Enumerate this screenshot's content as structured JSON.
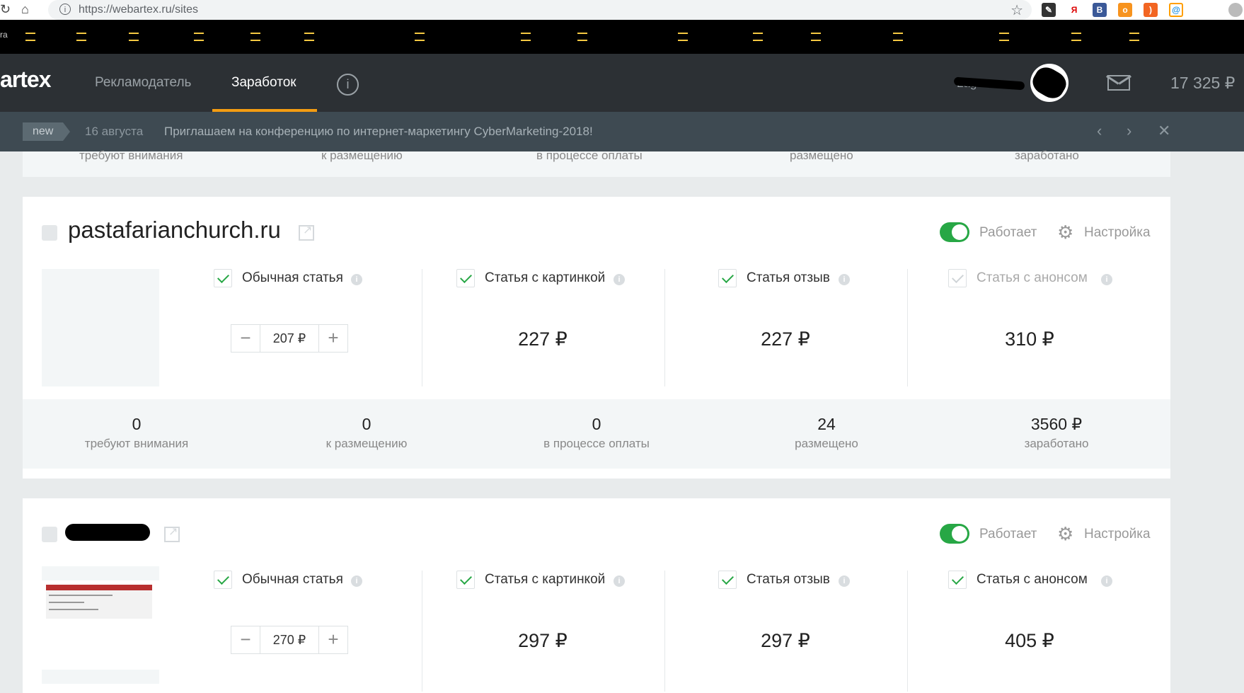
{
  "browser": {
    "url": "https://webartex.ru/sites",
    "bookmarks_left_text": "ra"
  },
  "header": {
    "logo": "artex",
    "nav": [
      "Рекламодатель",
      "Заработок"
    ],
    "user_name": "Lag",
    "balance": "17 325 ₽"
  },
  "announcement": {
    "badge": "new",
    "date": "16 августа",
    "text": "Приглашаем на конференцию по интернет-маркетингу CyberMarketing-2018!"
  },
  "top_strip": {
    "labels": [
      "требуют внимания",
      "к размещению",
      "в процессе оплаты",
      "размещено",
      "заработано"
    ]
  },
  "sites": [
    {
      "name": "pastafarianchurch.ru",
      "status": "Работает",
      "settings": "Настройка",
      "options": [
        {
          "label": "Обычная статья",
          "checked": true
        },
        {
          "label": "Статья с картинкой",
          "checked": true
        },
        {
          "label": "Статья отзыв",
          "checked": true
        },
        {
          "label": "Статья с анонсом",
          "checked": false
        }
      ],
      "stepper_value": "207 ₽",
      "prices": [
        "227 ₽",
        "227 ₽",
        "310 ₽"
      ],
      "stats": [
        {
          "value": "0",
          "label": "требуют внимания"
        },
        {
          "value": "0",
          "label": "к размещению"
        },
        {
          "value": "0",
          "label": "в процессе оплаты"
        },
        {
          "value": "24",
          "label": "размещено"
        },
        {
          "value": "3560 ₽",
          "label": "заработано"
        }
      ]
    },
    {
      "name": "",
      "status": "Работает",
      "settings": "Настройка",
      "options": [
        {
          "label": "Обычная статья",
          "checked": true
        },
        {
          "label": "Статья с картинкой",
          "checked": true
        },
        {
          "label": "Статья отзыв",
          "checked": true
        },
        {
          "label": "Статья с анонсом",
          "checked": true
        }
      ],
      "stepper_value": "270 ₽",
      "prices": [
        "297 ₽",
        "297 ₽",
        "405 ₽"
      ]
    }
  ],
  "colors": {
    "header_bg": "#2c3034",
    "announce_bg": "#3e4a52",
    "accent": "#f39c12",
    "toggle_on": "#27a745",
    "page_bg": "#e8ebec"
  }
}
